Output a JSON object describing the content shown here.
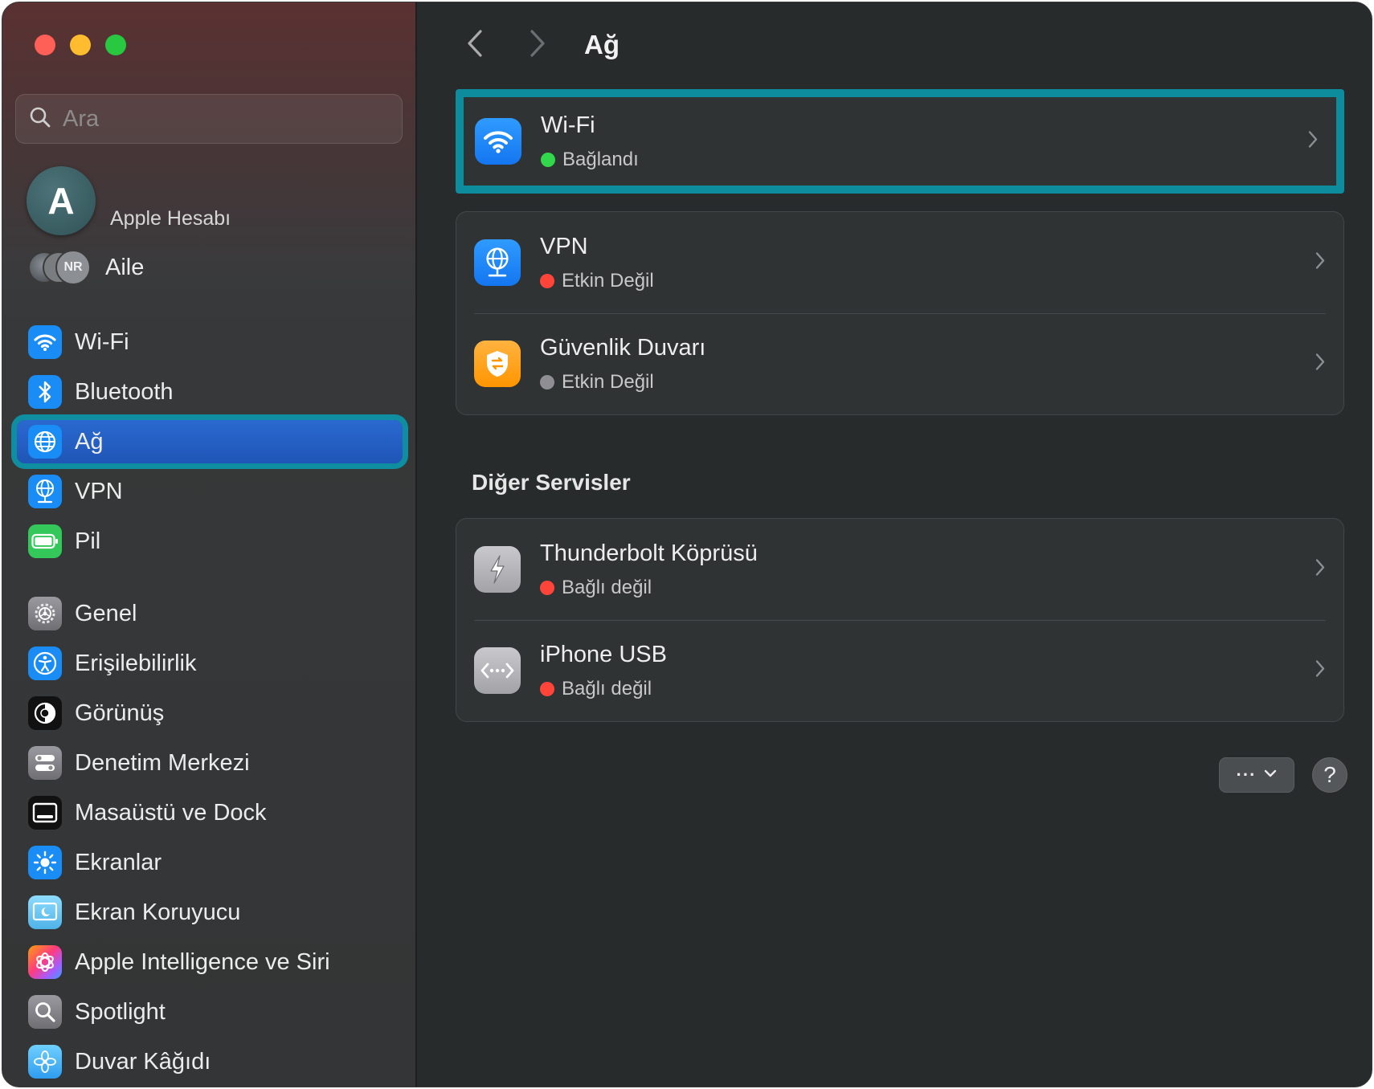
{
  "sidebar": {
    "search_placeholder": "Ara",
    "account_initial": "A",
    "account_label": "Apple Hesabı",
    "family_initials": "NR",
    "family_label": "Aile",
    "items": [
      {
        "label": "Wi-Fi",
        "icon": "wifi-icon",
        "color": "#1a8cf6"
      },
      {
        "label": "Bluetooth",
        "icon": "bluetooth-icon",
        "color": "#1a8cf6"
      },
      {
        "label": "Ağ",
        "icon": "globe-icon",
        "color": "#1a8cf6",
        "selected": true
      },
      {
        "label": "VPN",
        "icon": "vpn-globe-icon",
        "color": "#1a8cf6"
      },
      {
        "label": "Pil",
        "icon": "battery-icon",
        "color": "#34c759"
      },
      {
        "label": "Genel",
        "icon": "gear-icon",
        "color": "#8e8e93"
      },
      {
        "label": "Erişilebilirlik",
        "icon": "accessibility-icon",
        "color": "#1a8cf6"
      },
      {
        "label": "Görünüş",
        "icon": "appearance-icon",
        "color": "#111111"
      },
      {
        "label": "Denetim Merkezi",
        "icon": "control-center-icon",
        "color": "#8e8e93"
      },
      {
        "label": "Masaüstü ve Dock",
        "icon": "dock-icon",
        "color": "#111111"
      },
      {
        "label": "Ekranlar",
        "icon": "brightness-icon",
        "color": "#1a8cf6"
      },
      {
        "label": "Ekran Koruyucu",
        "icon": "screensaver-icon",
        "color": "#5ac8fa"
      },
      {
        "label": "Apple Intelligence ve Siri",
        "icon": "siri-icon",
        "color": "#ff6fb5"
      },
      {
        "label": "Spotlight",
        "icon": "spotlight-icon",
        "color": "#8e8e93"
      },
      {
        "label": "Duvar Kâğıdı",
        "icon": "wallpaper-icon",
        "color": "#5ac8fa"
      }
    ]
  },
  "main": {
    "title": "Ağ",
    "wifi": {
      "title": "Wi-Fi",
      "status": "Bağlandı",
      "status_color": "#32d74b"
    },
    "services": [
      {
        "title": "VPN",
        "status": "Etkin Değil",
        "status_color": "#ff453a",
        "icon": "vpn-globe-icon"
      },
      {
        "title": "Güvenlik Duvarı",
        "status": "Etkin Değil",
        "status_color": "#8e8e93",
        "icon": "firewall-shield-icon"
      }
    ],
    "other_services_title": "Diğer Servisler",
    "other_services": [
      {
        "title": "Thunderbolt Köprüsü",
        "status": "Bağlı değil",
        "status_color": "#ff453a",
        "icon": "thunderbolt-icon"
      },
      {
        "title": "iPhone USB",
        "status": "Bağlı değil",
        "status_color": "#ff453a",
        "icon": "usb-connection-icon"
      }
    ],
    "more_label": "···",
    "help_label": "?"
  }
}
